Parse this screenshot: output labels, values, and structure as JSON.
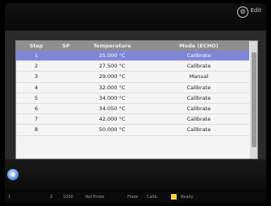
{
  "topbar": {
    "settings_icon": "gear-icon",
    "settings_label": "Edit"
  },
  "table": {
    "headers": [
      "Step",
      "SP",
      "Temperature",
      "Mode (ECHO)"
    ],
    "rows": [
      {
        "step": "1",
        "sp": "",
        "temp": "25.000 °C",
        "mode": "Calibrate"
      },
      {
        "step": "2",
        "sp": "",
        "temp": "27.500 °C",
        "mode": "Calibrate"
      },
      {
        "step": "3",
        "sp": "",
        "temp": "29.000 °C",
        "mode": "Manual"
      },
      {
        "step": "4",
        "sp": "",
        "temp": "32.000 °C",
        "mode": "Calibrate"
      },
      {
        "step": "5",
        "sp": "",
        "temp": "34.000 °C",
        "mode": "Calibrate"
      },
      {
        "step": "6",
        "sp": "",
        "temp": "34.050 °C",
        "mode": "Calibrate"
      },
      {
        "step": "7",
        "sp": "",
        "temp": "42.000 °C",
        "mode": "Calibrate"
      },
      {
        "step": "8",
        "sp": "",
        "temp": "50.000 °C",
        "mode": "Calibrate"
      }
    ]
  },
  "statusbar": {
    "items": [
      "1",
      "2",
      "1000",
      "Ref.Probe",
      "Fluke",
      "Calib.",
      "Ready"
    ]
  },
  "colors": {
    "selected_row": "#7f86d8",
    "status_square": "#f2d34a"
  }
}
